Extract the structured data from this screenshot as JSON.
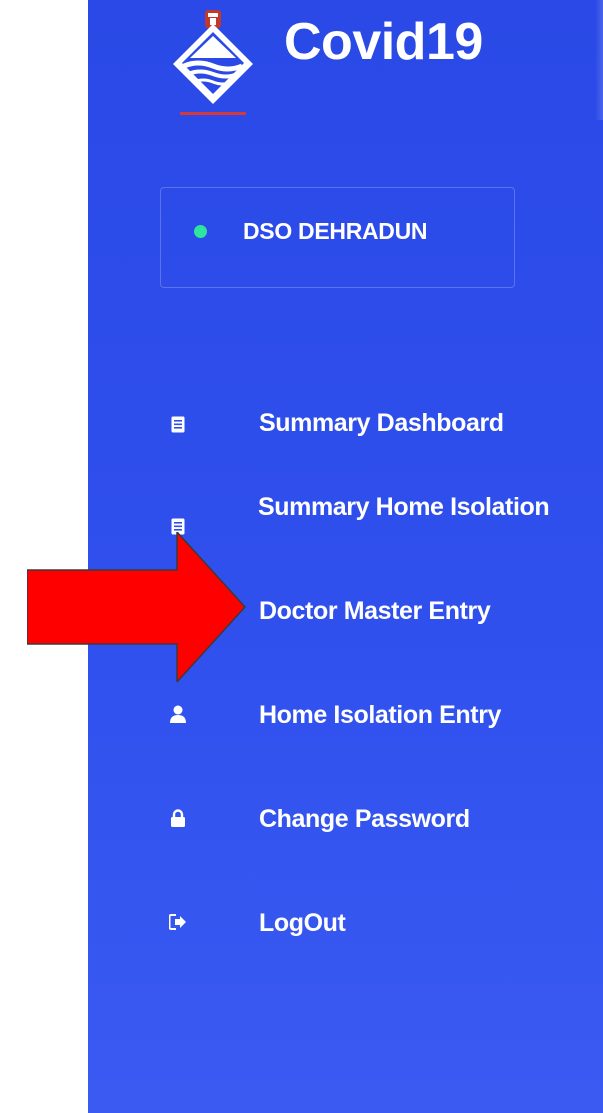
{
  "app": {
    "title": "Covid19",
    "logo_icon": "state-emblem-logo-icon"
  },
  "user": {
    "name": "DSO DEHRADUN",
    "status_color": "#2ee59d"
  },
  "menu": {
    "items": [
      {
        "label": "Summary Dashboard",
        "icon": "list-icon"
      },
      {
        "label": "Summary Home Isolation",
        "icon": "list-icon"
      },
      {
        "label": "Doctor Master Entry",
        "icon": "none"
      },
      {
        "label": "Home Isolation Entry",
        "icon": "user-icon"
      },
      {
        "label": "Change Password",
        "icon": "lock-icon"
      },
      {
        "label": "LogOut",
        "icon": "logout-icon"
      }
    ]
  },
  "annotation": {
    "arrow_color": "#ff0000",
    "arrow_target": "Doctor Master Entry"
  },
  "colors": {
    "sidebar_bg": "#2f4fec",
    "text": "#ffffff"
  }
}
